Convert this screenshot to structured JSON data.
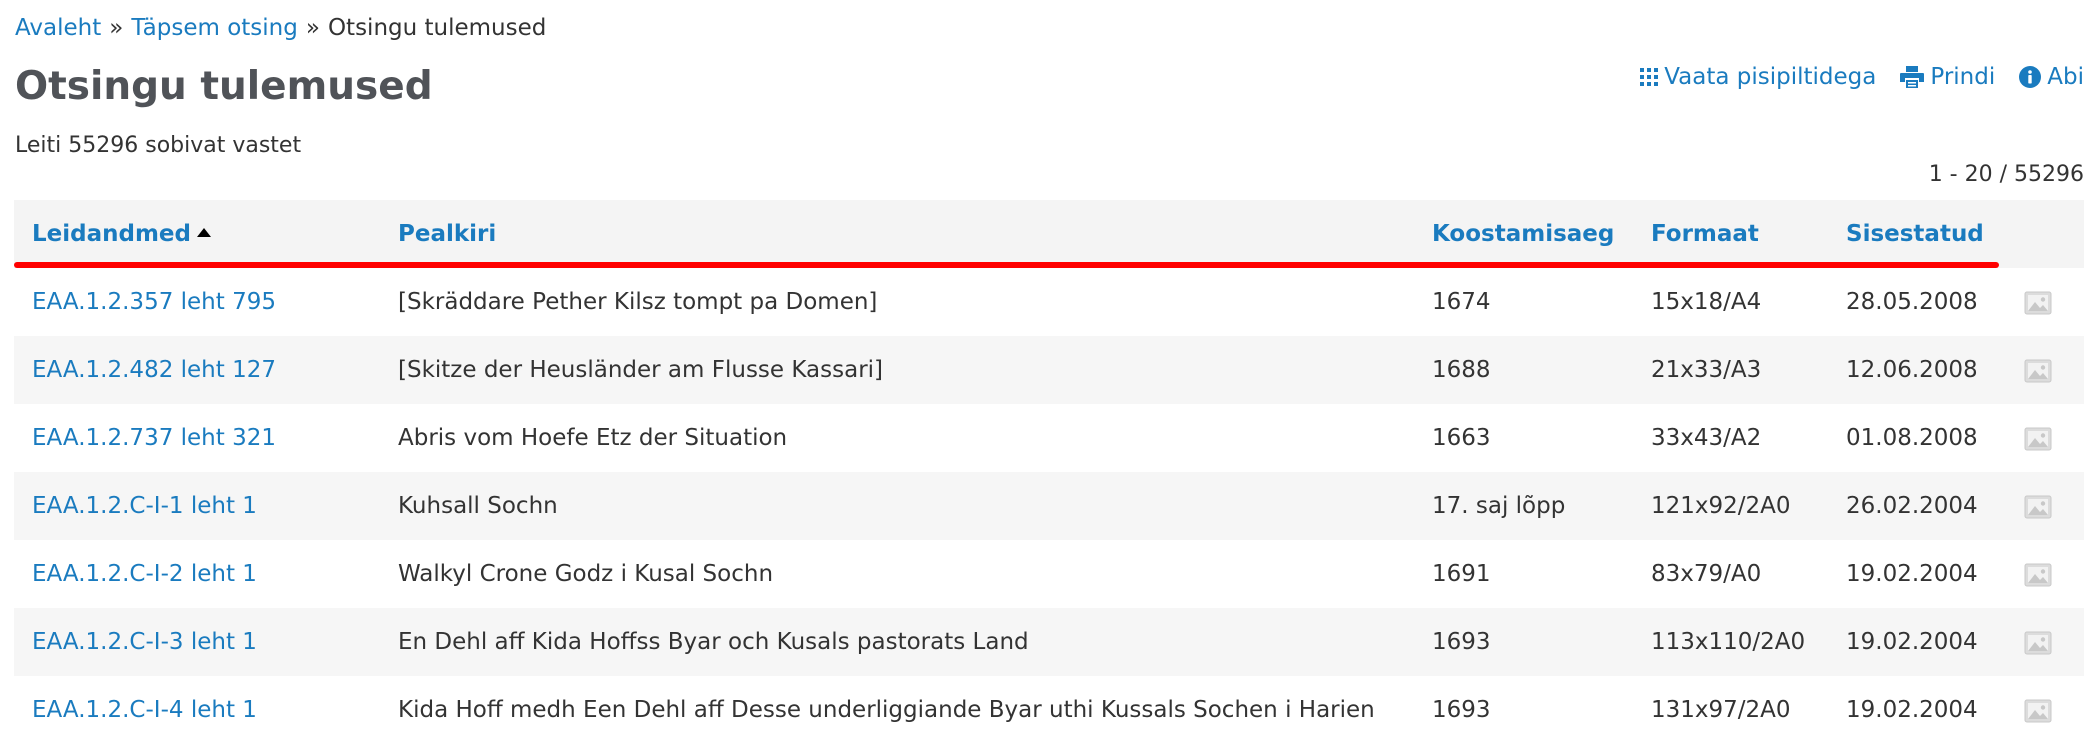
{
  "breadcrumb": {
    "items": [
      "Avaleht",
      "Täpsem otsing"
    ],
    "separator": "»",
    "current": "Otsingu tulemused"
  },
  "page": {
    "title": "Otsingu tulemused",
    "result_count": "Leiti 55296 sobivat vastet",
    "range": "1 - 20 / 55296"
  },
  "actions": {
    "thumbnails": {
      "label": "Vaata pisipiltidega",
      "icon": "grid-icon"
    },
    "print": {
      "label": "Prindi",
      "icon": "printer-icon"
    },
    "help": {
      "label": "Abi",
      "icon": "info-icon"
    }
  },
  "colors": {
    "link": "#1a7bbf",
    "title": "#505358",
    "highlight_underline": "#ff0000",
    "header_bg": "#f4f4f4"
  },
  "table": {
    "columns": [
      "Leidandmed",
      "Pealkiri",
      "Koostamisaeg",
      "Formaat",
      "Sisestatud"
    ],
    "sorted_column": "Leidandmed",
    "sort_direction": "ascending",
    "rows": [
      {
        "ref": "EAA.1.2.357 leht 795",
        "title": "[Skräddare Pether Kilsz tompt pa Domen]",
        "date": "1674",
        "format": "15x18/A4",
        "added": "28.05.2008"
      },
      {
        "ref": "EAA.1.2.482 leht 127",
        "title": "[Skitze der Heusländer am Flusse Kassari]",
        "date": "1688",
        "format": "21x33/A3",
        "added": "12.06.2008"
      },
      {
        "ref": "EAA.1.2.737 leht 321",
        "title": "Abris vom Hoefe Etz der Situation",
        "date": "1663",
        "format": "33x43/A2",
        "added": "01.08.2008"
      },
      {
        "ref": "EAA.1.2.C-I-1 leht 1",
        "title": "Kuhsall Sochn",
        "date": "17. saj lõpp",
        "format": "121x92/2A0",
        "added": "26.02.2004"
      },
      {
        "ref": "EAA.1.2.C-I-2 leht 1",
        "title": "Walkyl Crone Godz i Kusal Sochn",
        "date": "1691",
        "format": "83x79/A0",
        "added": "19.02.2004"
      },
      {
        "ref": "EAA.1.2.C-I-3 leht 1",
        "title": "En Dehl aff Kida Hoffss Byar och Kusals pastorats Land",
        "date": "1693",
        "format": "113x110/2A0",
        "added": "19.02.2004"
      },
      {
        "ref": "EAA.1.2.C-I-4 leht 1",
        "title": "Kida Hoff medh Een Dehl aff Desse underliggiande Byar uthi Kussals Sochen i Harien",
        "date": "1693",
        "format": "131x97/2A0",
        "added": "19.02.2004"
      }
    ],
    "row_icon": "image-placeholder-icon"
  }
}
